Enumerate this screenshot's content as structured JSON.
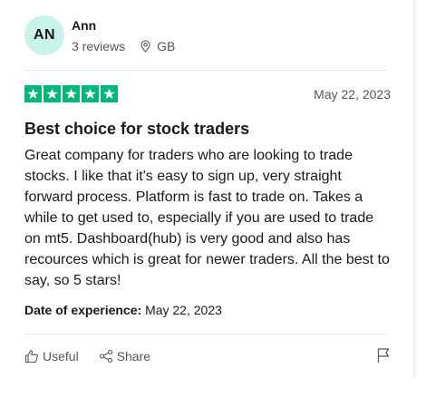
{
  "reviewer": {
    "initials": "AN",
    "name": "Ann",
    "reviews": "3 reviews",
    "country": "GB"
  },
  "rating": {
    "stars": 5,
    "max": 5,
    "color": "#00b67a"
  },
  "review": {
    "date": "May 22, 2023",
    "title": "Best choice for stock traders",
    "body": "Great company for traders who are looking to trade stocks. I like that it's easy to sign up, very straight forward process. Platform is fast to trade on. Takes a while to get used to, especially if you are used to trade on mt5. Dashboard(hub) is very good and also has recources which is great for newer traders. All the best to say, so 5 stars!",
    "experience_label": "Date of experience:",
    "experience_date": "May 22, 2023"
  },
  "actions": {
    "useful_label": "Useful",
    "share_label": "Share"
  },
  "icons": {
    "location": "location-pin-icon",
    "useful": "thumbs-up-icon",
    "share": "share-icon",
    "flag": "flag-icon",
    "star": "star-icon"
  },
  "colors": {
    "avatar_bg": "#c9f2ea",
    "star_green": "#00b67a"
  }
}
